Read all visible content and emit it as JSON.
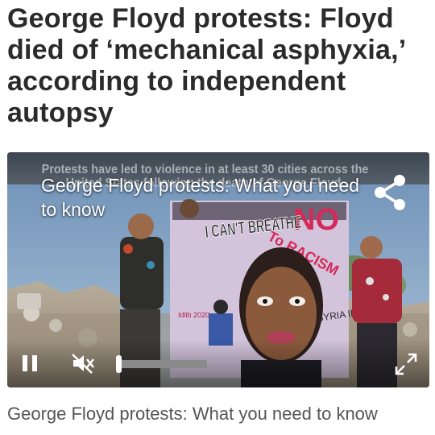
{
  "article": {
    "headline": "George Floyd protests: Floyd died of ‘mechanical asphyxia,’ according to independent autopsy"
  },
  "video": {
    "burned_in_text": "Protests have led to violence in at least 30 cities across the United States following the death of George Floyd.",
    "title": "George Floyd protests: What you need to know",
    "mural": {
      "text_main": "I CAN'T BREATHE",
      "text_no": "NO",
      "text_racism": "To RACISM",
      "text_signature": "SYRIA IDLIB",
      "text_small": "Idlib 2020"
    },
    "progress_fraction": 0.02,
    "colors": {
      "accent": "#ffffff",
      "track": "#8a8a8a"
    },
    "icons": {
      "share": "share-icon",
      "pause": "pause-icon",
      "mute": "volume-muted-icon",
      "expand": "expand-icon"
    }
  },
  "caption": {
    "text": "George Floyd protests: What you need to know"
  }
}
